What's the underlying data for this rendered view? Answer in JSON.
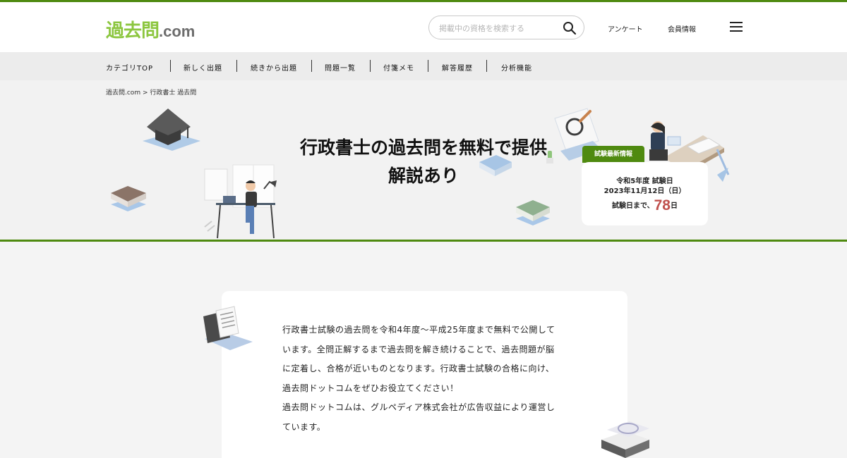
{
  "header": {
    "logo_kanji": "過去問",
    "logo_suffix": ".com",
    "search_placeholder": "掲載中の資格を検索する",
    "nav_survey": "アンケート",
    "nav_member": "会員情報"
  },
  "catnav": {
    "items": [
      "カテゴリTOP",
      "新しく出題",
      "続きから出題",
      "問題一覧",
      "付箋メモ",
      "解答履歴",
      "分析機能"
    ]
  },
  "breadcrumb": {
    "home": "過去問.com",
    "separator": ">",
    "current": "行政書士 過去問"
  },
  "hero": {
    "title_line1": "行政書士の過去問を無料で提供",
    "title_line2": "解説あり"
  },
  "exam_info": {
    "badge": "試験最新情報",
    "year_label": "令和5年度 試験日",
    "date": "2023年11月12日（日）",
    "days_prefix": "試験日まで、",
    "days_count": "78",
    "days_suffix": "日"
  },
  "intro": {
    "paragraph1": "行政書士試験の過去問を令和4年度～平成25年度まで無料で公開しています。全問正解するまで過去問を解き続けることで、過去問題が脳に定着し、合格が近いものとなります。行政書士試験の合格に向け、過去問ドットコムをぜひお役立てください！",
    "paragraph2": "過去問ドットコムは、グルペディア株式会社が広告収益により運営しています。"
  },
  "colors": {
    "brand_green": "#4f8a10",
    "logo_green": "#8cc63f",
    "countdown_red": "#c0504d"
  }
}
